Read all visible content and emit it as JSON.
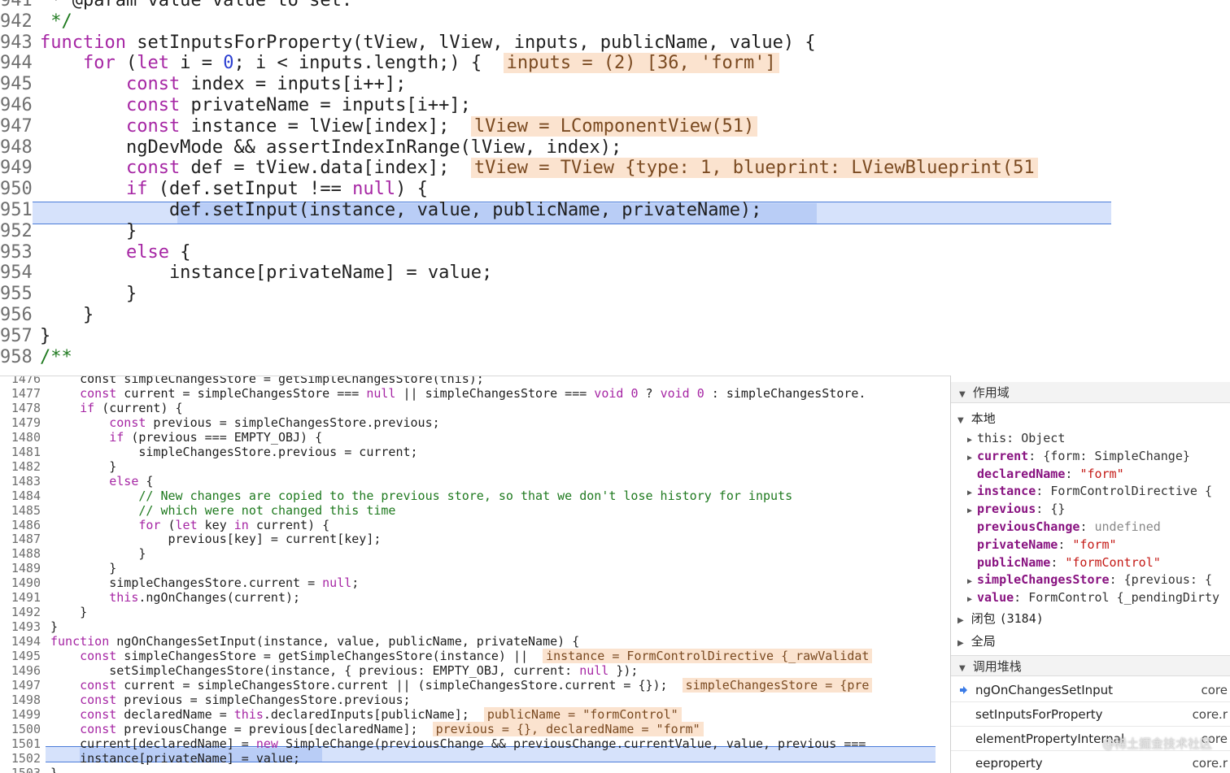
{
  "top_editor": {
    "lines": [
      {
        "n": "941",
        "code": [
          {
            "t": " * @param value value to set."
          }
        ]
      },
      {
        "n": "942",
        "code": [
          {
            "t": " */",
            "c": "cmt"
          }
        ]
      },
      {
        "n": "943",
        "code": [
          {
            "t": "function",
            "c": "kw"
          },
          {
            "t": " setInputsForProperty(tView, lView, inputs, publicName, value) {"
          }
        ]
      },
      {
        "n": "944",
        "code": [
          {
            "t": "    "
          },
          {
            "t": "for",
            "c": "kw"
          },
          {
            "t": " ("
          },
          {
            "t": "let",
            "c": "kw"
          },
          {
            "t": " i = "
          },
          {
            "t": "0",
            "c": "num"
          },
          {
            "t": "; i < inputs.length;) {  "
          },
          {
            "t": "inputs = (2) [36, 'form']",
            "c": "inline-val"
          }
        ]
      },
      {
        "n": "945",
        "code": [
          {
            "t": "        "
          },
          {
            "t": "const",
            "c": "kw"
          },
          {
            "t": " index = inputs[i++];"
          }
        ]
      },
      {
        "n": "946",
        "code": [
          {
            "t": "        "
          },
          {
            "t": "const",
            "c": "kw"
          },
          {
            "t": " privateName = inputs[i++];"
          }
        ]
      },
      {
        "n": "947",
        "code": [
          {
            "t": "        "
          },
          {
            "t": "const",
            "c": "kw"
          },
          {
            "t": " instance = lView[index];  "
          },
          {
            "t": "lView = LComponentView(51)",
            "c": "inline-val"
          }
        ]
      },
      {
        "n": "948",
        "code": [
          {
            "t": "        ngDevMode && assertIndexInRange(lView, index);"
          }
        ]
      },
      {
        "n": "949",
        "code": [
          {
            "t": "        "
          },
          {
            "t": "const",
            "c": "kw"
          },
          {
            "t": " def = tView.data[index];  "
          },
          {
            "t": "tView = TView {type: 1, blueprint: LViewBlueprint(51",
            "c": "inline-val"
          }
        ]
      },
      {
        "n": "950",
        "code": [
          {
            "t": "        "
          },
          {
            "t": "if",
            "c": "kw"
          },
          {
            "t": " (def.setInput !== "
          },
          {
            "t": "null",
            "c": "kw"
          },
          {
            "t": ") {"
          }
        ]
      },
      {
        "n": "951",
        "code": [
          {
            "t": "            def.setInput(instance, value, publicName, privateName);"
          }
        ]
      },
      {
        "n": "952",
        "code": [
          {
            "t": "        }"
          }
        ]
      },
      {
        "n": "953",
        "code": [
          {
            "t": "        "
          },
          {
            "t": "else",
            "c": "kw"
          },
          {
            "t": " {"
          }
        ]
      },
      {
        "n": "954",
        "code": [
          {
            "t": "            instance[privateName] = value;"
          }
        ]
      },
      {
        "n": "955",
        "code": [
          {
            "t": "        }"
          }
        ]
      },
      {
        "n": "956",
        "code": [
          {
            "t": "    }"
          }
        ]
      },
      {
        "n": "957",
        "code": [
          {
            "t": "}"
          }
        ]
      },
      {
        "n": "958",
        "code": [
          {
            "t": "/**",
            "c": "cmt"
          }
        ]
      }
    ]
  },
  "bottom_editor": {
    "lines": [
      {
        "n": "1476",
        "code": [
          {
            "t": "    const simpleChangesStore = getSimpleChangesStore(this);"
          }
        ]
      },
      {
        "n": "1477",
        "code": [
          {
            "t": "    "
          },
          {
            "t": "const",
            "c": "kw"
          },
          {
            "t": " current = simpleChangesStore === "
          },
          {
            "t": "null",
            "c": "kw"
          },
          {
            "t": " || simpleChangesStore === "
          },
          {
            "t": "void 0",
            "c": "kw"
          },
          {
            "t": " ? "
          },
          {
            "t": "void 0",
            "c": "kw"
          },
          {
            "t": " : simpleChangesStore."
          }
        ]
      },
      {
        "n": "1478",
        "code": [
          {
            "t": "    "
          },
          {
            "t": "if",
            "c": "kw"
          },
          {
            "t": " (current) {"
          }
        ]
      },
      {
        "n": "1479",
        "code": [
          {
            "t": "        "
          },
          {
            "t": "const",
            "c": "kw"
          },
          {
            "t": " previous = simpleChangesStore.previous;"
          }
        ]
      },
      {
        "n": "1480",
        "code": [
          {
            "t": "        "
          },
          {
            "t": "if",
            "c": "kw"
          },
          {
            "t": " (previous === EMPTY_OBJ) {"
          }
        ]
      },
      {
        "n": "1481",
        "code": [
          {
            "t": "            simpleChangesStore.previous = current;"
          }
        ]
      },
      {
        "n": "1482",
        "code": [
          {
            "t": "        }"
          }
        ]
      },
      {
        "n": "1483",
        "code": [
          {
            "t": "        "
          },
          {
            "t": "else",
            "c": "kw"
          },
          {
            "t": " {"
          }
        ]
      },
      {
        "n": "1484",
        "code": [
          {
            "t": "            "
          },
          {
            "t": "// New changes are copied to the previous store, so that we don't lose history for inputs",
            "c": "cmt"
          }
        ]
      },
      {
        "n": "1485",
        "code": [
          {
            "t": "            "
          },
          {
            "t": "// which were not changed this time",
            "c": "cmt"
          }
        ]
      },
      {
        "n": "1486",
        "code": [
          {
            "t": "            "
          },
          {
            "t": "for",
            "c": "kw"
          },
          {
            "t": " ("
          },
          {
            "t": "let",
            "c": "kw"
          },
          {
            "t": " key "
          },
          {
            "t": "in",
            "c": "kw"
          },
          {
            "t": " current) {"
          }
        ]
      },
      {
        "n": "1487",
        "code": [
          {
            "t": "                previous[key] = current[key];"
          }
        ]
      },
      {
        "n": "1488",
        "code": [
          {
            "t": "            }"
          }
        ]
      },
      {
        "n": "1489",
        "code": [
          {
            "t": "        }"
          }
        ]
      },
      {
        "n": "1490",
        "code": [
          {
            "t": "        simpleChangesStore.current = "
          },
          {
            "t": "null",
            "c": "kw"
          },
          {
            "t": ";"
          }
        ]
      },
      {
        "n": "1491",
        "code": [
          {
            "t": "        "
          },
          {
            "t": "this",
            "c": "kw"
          },
          {
            "t": ".ngOnChanges(current);"
          }
        ]
      },
      {
        "n": "1492",
        "code": [
          {
            "t": "    }"
          }
        ]
      },
      {
        "n": "1493",
        "code": [
          {
            "t": "}"
          }
        ]
      },
      {
        "n": "1494",
        "code": [
          {
            "t": "function",
            "c": "kw"
          },
          {
            "t": " ngOnChangesSetInput(instance, value, publicName, privateName) {"
          }
        ]
      },
      {
        "n": "1495",
        "code": [
          {
            "t": "    "
          },
          {
            "t": "const",
            "c": "kw"
          },
          {
            "t": " simpleChangesStore = getSimpleChangesStore(instance) ||  "
          },
          {
            "t": "instance = FormControlDirective {_rawValidat",
            "c": "inline-val"
          }
        ]
      },
      {
        "n": "1496",
        "code": [
          {
            "t": "        setSimpleChangesStore(instance, { previous: EMPTY_OBJ, current: "
          },
          {
            "t": "null",
            "c": "kw"
          },
          {
            "t": " });"
          }
        ]
      },
      {
        "n": "1497",
        "code": [
          {
            "t": "    "
          },
          {
            "t": "const",
            "c": "kw"
          },
          {
            "t": " current = simpleChangesStore.current || (simpleChangesStore.current = {});  "
          },
          {
            "t": "simpleChangesStore = {pre",
            "c": "inline-val"
          }
        ]
      },
      {
        "n": "1498",
        "code": [
          {
            "t": "    "
          },
          {
            "t": "const",
            "c": "kw"
          },
          {
            "t": " previous = simpleChangesStore.previous;"
          }
        ]
      },
      {
        "n": "1499",
        "code": [
          {
            "t": "    "
          },
          {
            "t": "const",
            "c": "kw"
          },
          {
            "t": " declaredName = "
          },
          {
            "t": "this",
            "c": "kw"
          },
          {
            "t": ".declaredInputs[publicName];  "
          },
          {
            "t": "publicName = \"formControl\"",
            "c": "inline-val"
          }
        ]
      },
      {
        "n": "1500",
        "code": [
          {
            "t": "    "
          },
          {
            "t": "const",
            "c": "kw"
          },
          {
            "t": " previousChange = previous[declaredName];  "
          },
          {
            "t": "previous = {}, declaredName = \"form\"",
            "c": "inline-val"
          }
        ]
      },
      {
        "n": "1501",
        "code": [
          {
            "t": "    current[declaredName] = "
          },
          {
            "t": "new",
            "c": "kw"
          },
          {
            "t": " SimpleChange(previousChange && previousChange.currentValue, value, previous ==="
          }
        ]
      },
      {
        "n": "1502",
        "code": [
          {
            "t": "    instance[privateName] = value;"
          }
        ]
      },
      {
        "n": "1503",
        "code": [
          {
            "t": "}"
          }
        ]
      }
    ]
  },
  "sidebar": {
    "scope_header": "作用域",
    "local_header": "本地",
    "locals": [
      {
        "name": "this",
        "sep": ": ",
        "value": "Object",
        "expandable": true,
        "kind": "plain",
        "vtype": "val"
      },
      {
        "name": "current",
        "sep": ": ",
        "value": "{form: SimpleChange}",
        "expandable": true,
        "kind": "bold",
        "vtype": "val"
      },
      {
        "name": "declaredName",
        "sep": ": ",
        "value": "\"form\"",
        "expandable": false,
        "kind": "bold",
        "vtype": "str"
      },
      {
        "name": "instance",
        "sep": ": ",
        "value": "FormControlDirective {",
        "expandable": true,
        "kind": "bold",
        "vtype": "val"
      },
      {
        "name": "previous",
        "sep": ": ",
        "value": "{}",
        "expandable": true,
        "kind": "bold",
        "vtype": "val"
      },
      {
        "name": "previousChange",
        "sep": ": ",
        "value": "undefined",
        "expandable": false,
        "kind": "bold",
        "vtype": "undef"
      },
      {
        "name": "privateName",
        "sep": ": ",
        "value": "\"form\"",
        "expandable": false,
        "kind": "bold",
        "vtype": "str"
      },
      {
        "name": "publicName",
        "sep": ": ",
        "value": "\"formControl\"",
        "expandable": false,
        "kind": "bold",
        "vtype": "str"
      },
      {
        "name": "simpleChangesStore",
        "sep": ": ",
        "value": "{previous: {",
        "expandable": true,
        "kind": "bold",
        "vtype": "val"
      },
      {
        "name": "value",
        "sep": ": ",
        "value": "FormControl {_pendingDirty",
        "expandable": true,
        "kind": "bold",
        "vtype": "val"
      }
    ],
    "closure_label": "闭包",
    "closure_count": "(3184)",
    "global_label": "全局",
    "callstack_header": "调用堆栈",
    "callstack": [
      {
        "fn": "ngOnChangesSetInput",
        "file": "core",
        "active": true
      },
      {
        "fn": "setInputsForProperty",
        "file": "core.r",
        "active": false
      },
      {
        "fn": "elementPropertyInternal",
        "file": "core",
        "active": false
      },
      {
        "fn": "eeproperty",
        "file": "core.r",
        "active": false
      }
    ]
  },
  "watermark": "@稀土掘金技术社区",
  "colors": {
    "highlight": "#d6e2fb",
    "highlight_border": "#4a7bd8",
    "inline_value_bg": "#fbe3cf",
    "keyword": "#a626a4",
    "comment": "#1f7a1f",
    "var_name": "#881280",
    "string": "#c41a16"
  }
}
